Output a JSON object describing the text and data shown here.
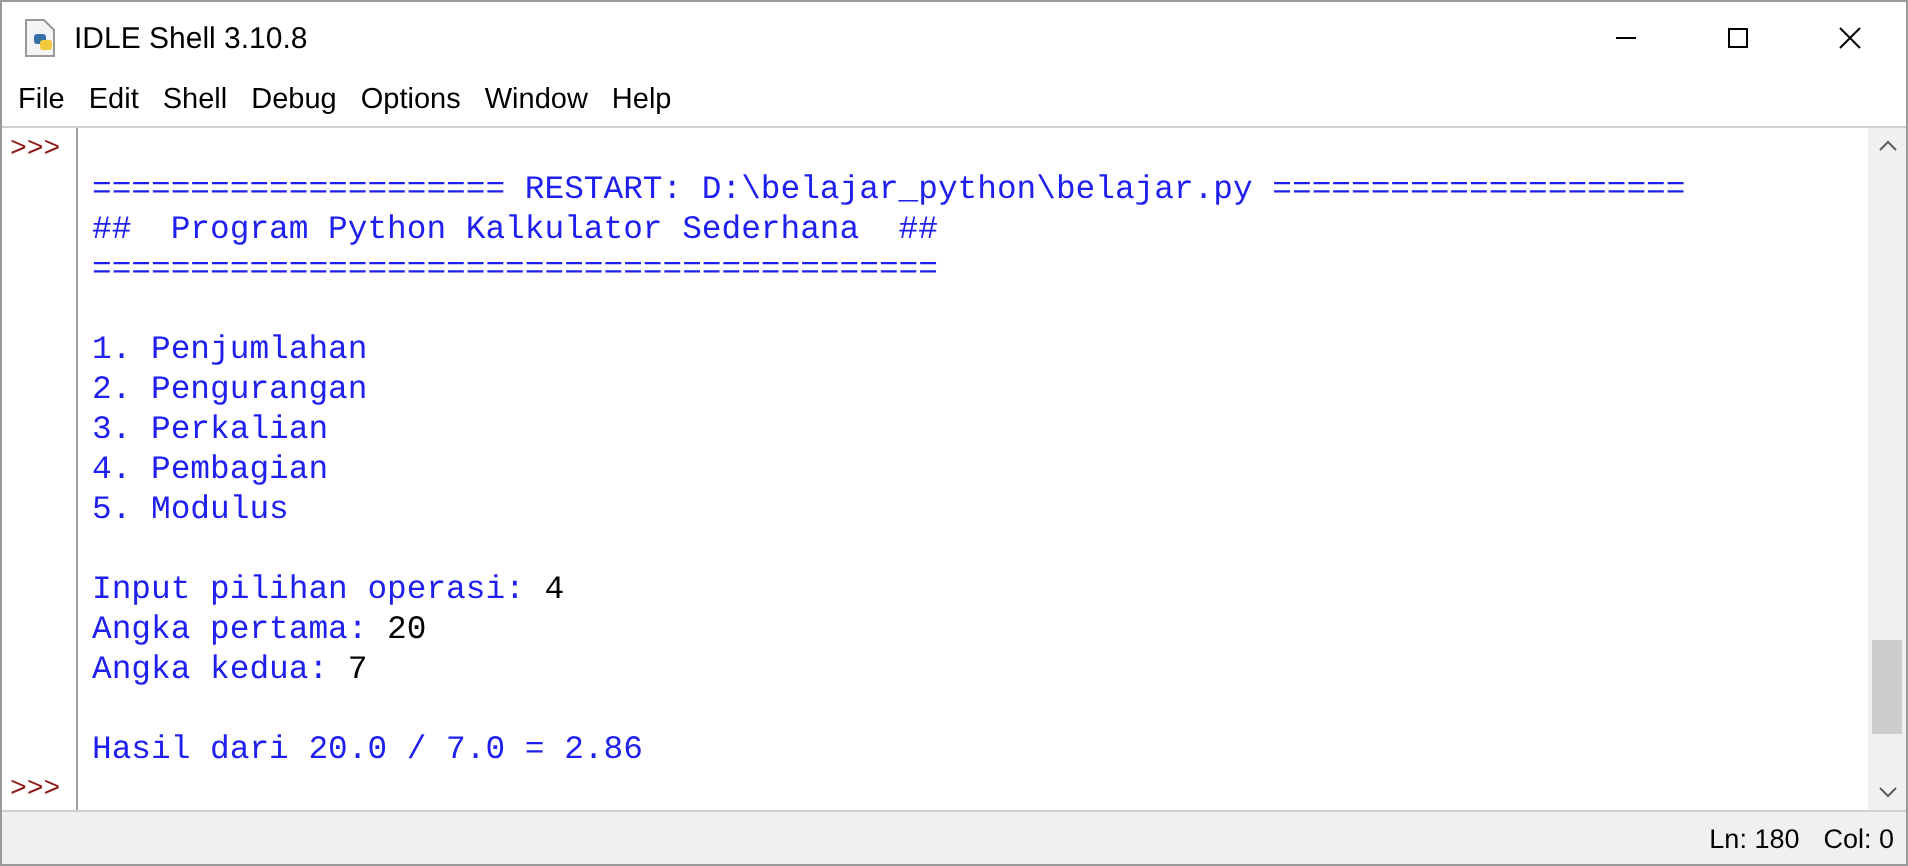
{
  "window": {
    "title": "IDLE Shell 3.10.8"
  },
  "menu": [
    "File",
    "Edit",
    "Shell",
    "Debug",
    "Options",
    "Window",
    "Help"
  ],
  "shell": {
    "prompts": [
      ">>>",
      ">>>"
    ],
    "blocks": [
      [
        [
          {
            "kind": "output",
            "text": "===================== RESTART: D:\\belajar_python\\belajar.py ====================="
          }
        ],
        [
          {
            "kind": "output",
            "text": "##  Program Python Kalkulator Sederhana  ##"
          }
        ],
        [
          {
            "kind": "output",
            "text": "==========================================="
          }
        ]
      ],
      [
        [
          {
            "kind": "output",
            "text": "1. Penjumlahan"
          }
        ],
        [
          {
            "kind": "output",
            "text": "2. Pengurangan"
          }
        ],
        [
          {
            "kind": "output",
            "text": "3. Perkalian"
          }
        ],
        [
          {
            "kind": "output",
            "text": "4. Pembagian"
          }
        ],
        [
          {
            "kind": "output",
            "text": "5. Modulus"
          }
        ]
      ],
      [
        [
          {
            "kind": "output",
            "text": "Input pilihan operasi: "
          },
          {
            "kind": "input",
            "text": "4"
          }
        ],
        [
          {
            "kind": "output",
            "text": "Angka pertama: "
          },
          {
            "kind": "input",
            "text": "20"
          }
        ],
        [
          {
            "kind": "output",
            "text": "Angka kedua: "
          },
          {
            "kind": "input",
            "text": "7"
          }
        ]
      ],
      [
        [
          {
            "kind": "output",
            "text": "Hasil dari 20.0 / 7.0 = 2.86"
          }
        ]
      ]
    ]
  },
  "status_bar": {
    "line": "Ln: 180",
    "column": "Col: 0"
  }
}
